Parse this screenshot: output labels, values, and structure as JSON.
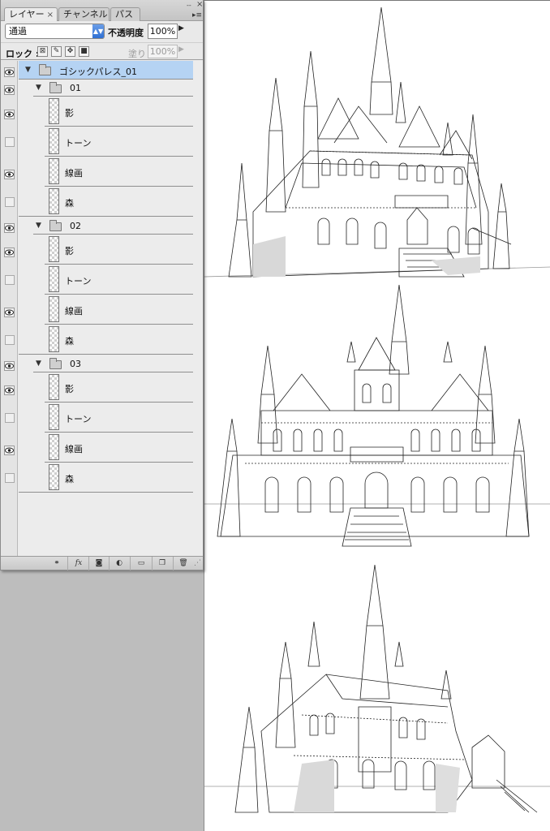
{
  "panel": {
    "tabs": [
      {
        "label": "レイヤー",
        "close": "×"
      },
      {
        "label": "チャンネル"
      },
      {
        "label": "パス"
      }
    ],
    "minimize_glyph": "--",
    "close_glyph": "×",
    "menu_glyph": "▸≡",
    "blend_mode": "通過",
    "opacity_label": "不透明度 :",
    "opacity_value": "100%",
    "lock_label": "ロック :",
    "fill_label": "塗り :",
    "fill_value": "100%"
  },
  "layers": {
    "root_group": "ゴシックパレス_01",
    "groups": [
      {
        "name": "01",
        "visible": true,
        "layers": [
          {
            "name": "影",
            "visible": true
          },
          {
            "name": "トーン",
            "visible": false
          },
          {
            "name": "線画",
            "visible": true
          },
          {
            "name": "森",
            "visible": false
          }
        ]
      },
      {
        "name": "02",
        "visible": true,
        "layers": [
          {
            "name": "影",
            "visible": true
          },
          {
            "name": "トーン",
            "visible": false
          },
          {
            "name": "線画",
            "visible": true
          },
          {
            "name": "森",
            "visible": false
          }
        ]
      },
      {
        "name": "03",
        "visible": true,
        "layers": [
          {
            "name": "影",
            "visible": true
          },
          {
            "name": "トーン",
            "visible": false
          },
          {
            "name": "線画",
            "visible": true
          },
          {
            "name": "森",
            "visible": false
          }
        ]
      }
    ]
  },
  "footer_buttons": [
    "link-layers-icon",
    "fx-icon",
    "layer-mask-icon",
    "adjustment-layer-icon",
    "new-group-icon",
    "new-layer-icon",
    "trash-icon"
  ],
  "footer_labels": {
    "fx": "fx"
  },
  "colors": {
    "selected_row": "#b5d3f3",
    "panel_bg": "#e9e9e9",
    "workspace_bg": "#bdbdbd"
  }
}
